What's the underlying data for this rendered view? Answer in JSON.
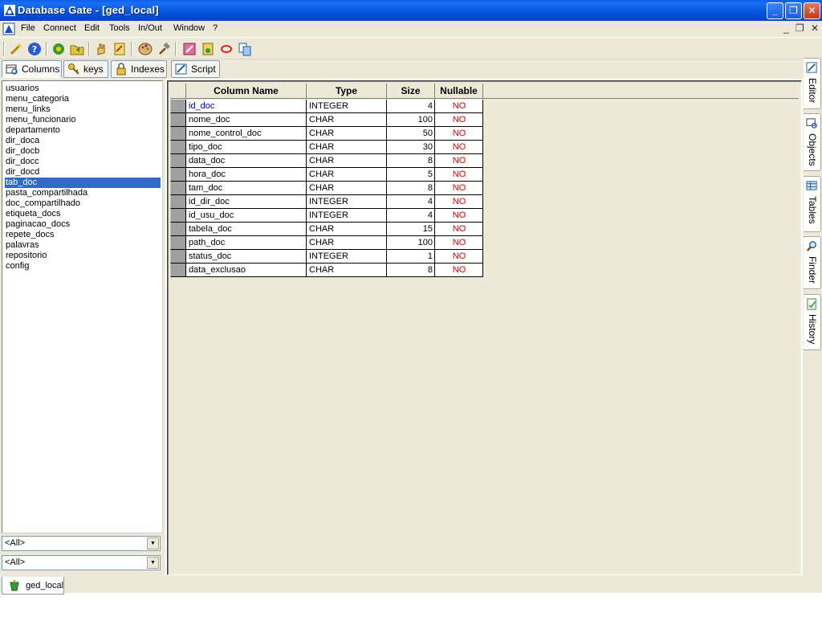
{
  "window": {
    "title": "Database Gate - [ged_local]",
    "controls": [
      "_",
      "❐",
      "✕"
    ],
    "mdi_controls": [
      "_",
      "❐",
      "✕"
    ]
  },
  "menu": [
    "File",
    "Connect",
    "Edit",
    "Tools",
    "In/Out",
    "Window",
    "?"
  ],
  "tabs": [
    {
      "label": "Columns",
      "icon": "columns-icon",
      "active": true
    },
    {
      "label": "keys",
      "icon": "key-icon",
      "active": false
    },
    {
      "label": "Indexes",
      "icon": "index-icon",
      "active": false
    },
    {
      "label": "Script",
      "icon": "script-icon",
      "active": false
    }
  ],
  "tables": [
    "usuarios",
    "menu_categoria",
    "menu_links",
    "menu_funcionario",
    "departamento",
    "dir_doca",
    "dir_docb",
    "dir_docc",
    "dir_docd",
    "tab_doc",
    "pasta_compartilhada",
    "doc_compartilhado",
    "etiqueta_docs",
    "paginacao_docs",
    "repete_docs",
    "palavras",
    "repositorio",
    "config"
  ],
  "selected_table": "tab_doc",
  "filters": [
    "<All>",
    "<All>"
  ],
  "grid": {
    "headers": [
      "Column Name",
      "Type",
      "Size",
      "Nullable"
    ],
    "rows": [
      [
        "id_doc",
        "INTEGER",
        "4",
        "NO"
      ],
      [
        "nome_doc",
        "CHAR",
        "100",
        "NO"
      ],
      [
        "nome_control_doc",
        "CHAR",
        "50",
        "NO"
      ],
      [
        "tipo_doc",
        "CHAR",
        "30",
        "NO"
      ],
      [
        "data_doc",
        "CHAR",
        "8",
        "NO"
      ],
      [
        "hora_doc",
        "CHAR",
        "5",
        "NO"
      ],
      [
        "tam_doc",
        "CHAR",
        "8",
        "NO"
      ],
      [
        "id_dir_doc",
        "INTEGER",
        "4",
        "NO"
      ],
      [
        "id_usu_doc",
        "INTEGER",
        "4",
        "NO"
      ],
      [
        "tabela_doc",
        "CHAR",
        "15",
        "NO"
      ],
      [
        "path_doc",
        "CHAR",
        "100",
        "NO"
      ],
      [
        "status_doc",
        "INTEGER",
        "1",
        "NO"
      ],
      [
        "data_exclusao",
        "CHAR",
        "8",
        "NO"
      ]
    ]
  },
  "side_tabs": [
    {
      "label": "Editor",
      "icon": "pencil-icon"
    },
    {
      "label": "Objects",
      "icon": "objects-icon"
    },
    {
      "label": "Tables",
      "icon": "table-icon",
      "active": true
    },
    {
      "label": "Finder",
      "icon": "magnifier-icon"
    },
    {
      "label": "History",
      "icon": "history-icon"
    }
  ],
  "connection_tab": "ged_local",
  "colors": {
    "title_bar": "#0556e0",
    "selection": "#316ac5",
    "nullable_no": "#e00000",
    "first_column": "#0000c0"
  }
}
